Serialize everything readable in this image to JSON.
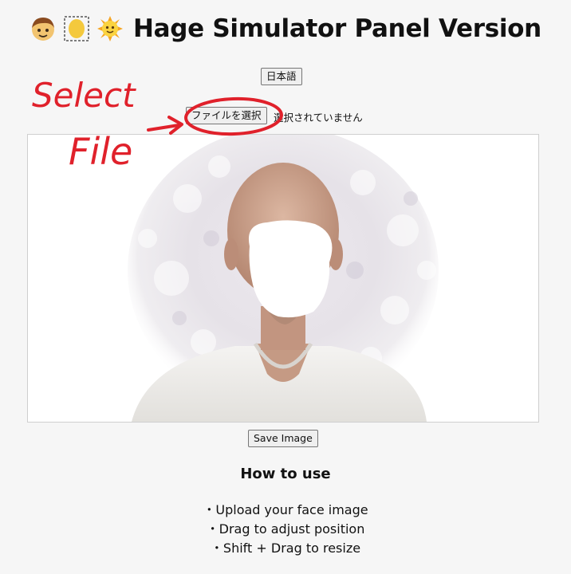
{
  "header": {
    "title": "Hage Simulator Panel Version",
    "emoji_icons": [
      "boy-face-icon",
      "bald-head-dashed-icon",
      "sun-face-icon"
    ]
  },
  "controls": {
    "language_button": "日本語",
    "file_button": "ファイルを選択",
    "file_status": "選択されていません",
    "save_button": "Save Image"
  },
  "annotation": {
    "line1": "Select",
    "line2": "File",
    "color": "#e0212b"
  },
  "howto": {
    "title": "How to use",
    "items": [
      "・Upload your face image",
      "・Drag to adjust position",
      "・Shift + Drag to resize"
    ]
  }
}
